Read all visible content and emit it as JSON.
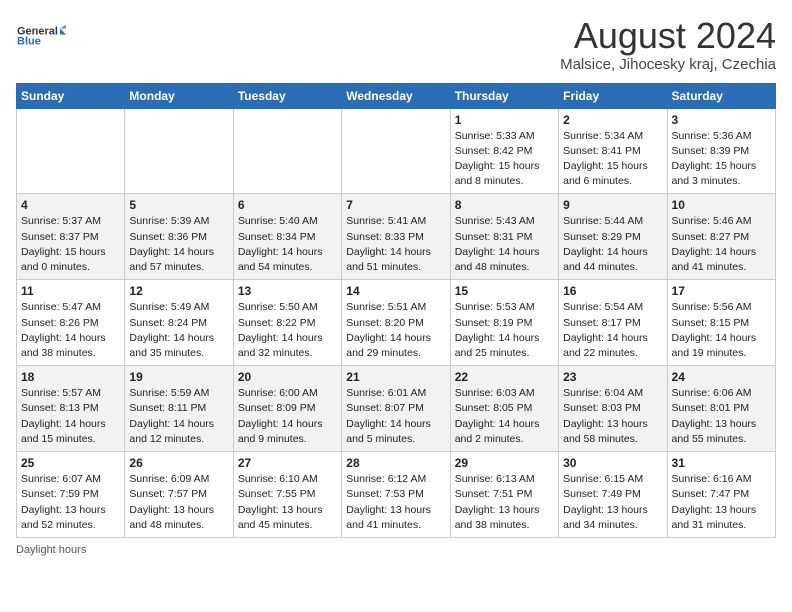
{
  "logo": {
    "line1": "General",
    "line2": "Blue"
  },
  "title": "August 2024",
  "location": "Malsice, Jihocesky kraj, Czechia",
  "days_of_week": [
    "Sunday",
    "Monday",
    "Tuesday",
    "Wednesday",
    "Thursday",
    "Friday",
    "Saturday"
  ],
  "footer_note": "Daylight hours",
  "weeks": [
    [
      {
        "day": "",
        "info": ""
      },
      {
        "day": "",
        "info": ""
      },
      {
        "day": "",
        "info": ""
      },
      {
        "day": "",
        "info": ""
      },
      {
        "day": "1",
        "info": "Sunrise: 5:33 AM\nSunset: 8:42 PM\nDaylight: 15 hours\nand 8 minutes."
      },
      {
        "day": "2",
        "info": "Sunrise: 5:34 AM\nSunset: 8:41 PM\nDaylight: 15 hours\nand 6 minutes."
      },
      {
        "day": "3",
        "info": "Sunrise: 5:36 AM\nSunset: 8:39 PM\nDaylight: 15 hours\nand 3 minutes."
      }
    ],
    [
      {
        "day": "4",
        "info": "Sunrise: 5:37 AM\nSunset: 8:37 PM\nDaylight: 15 hours\nand 0 minutes."
      },
      {
        "day": "5",
        "info": "Sunrise: 5:39 AM\nSunset: 8:36 PM\nDaylight: 14 hours\nand 57 minutes."
      },
      {
        "day": "6",
        "info": "Sunrise: 5:40 AM\nSunset: 8:34 PM\nDaylight: 14 hours\nand 54 minutes."
      },
      {
        "day": "7",
        "info": "Sunrise: 5:41 AM\nSunset: 8:33 PM\nDaylight: 14 hours\nand 51 minutes."
      },
      {
        "day": "8",
        "info": "Sunrise: 5:43 AM\nSunset: 8:31 PM\nDaylight: 14 hours\nand 48 minutes."
      },
      {
        "day": "9",
        "info": "Sunrise: 5:44 AM\nSunset: 8:29 PM\nDaylight: 14 hours\nand 44 minutes."
      },
      {
        "day": "10",
        "info": "Sunrise: 5:46 AM\nSunset: 8:27 PM\nDaylight: 14 hours\nand 41 minutes."
      }
    ],
    [
      {
        "day": "11",
        "info": "Sunrise: 5:47 AM\nSunset: 8:26 PM\nDaylight: 14 hours\nand 38 minutes."
      },
      {
        "day": "12",
        "info": "Sunrise: 5:49 AM\nSunset: 8:24 PM\nDaylight: 14 hours\nand 35 minutes."
      },
      {
        "day": "13",
        "info": "Sunrise: 5:50 AM\nSunset: 8:22 PM\nDaylight: 14 hours\nand 32 minutes."
      },
      {
        "day": "14",
        "info": "Sunrise: 5:51 AM\nSunset: 8:20 PM\nDaylight: 14 hours\nand 29 minutes."
      },
      {
        "day": "15",
        "info": "Sunrise: 5:53 AM\nSunset: 8:19 PM\nDaylight: 14 hours\nand 25 minutes."
      },
      {
        "day": "16",
        "info": "Sunrise: 5:54 AM\nSunset: 8:17 PM\nDaylight: 14 hours\nand 22 minutes."
      },
      {
        "day": "17",
        "info": "Sunrise: 5:56 AM\nSunset: 8:15 PM\nDaylight: 14 hours\nand 19 minutes."
      }
    ],
    [
      {
        "day": "18",
        "info": "Sunrise: 5:57 AM\nSunset: 8:13 PM\nDaylight: 14 hours\nand 15 minutes."
      },
      {
        "day": "19",
        "info": "Sunrise: 5:59 AM\nSunset: 8:11 PM\nDaylight: 14 hours\nand 12 minutes."
      },
      {
        "day": "20",
        "info": "Sunrise: 6:00 AM\nSunset: 8:09 PM\nDaylight: 14 hours\nand 9 minutes."
      },
      {
        "day": "21",
        "info": "Sunrise: 6:01 AM\nSunset: 8:07 PM\nDaylight: 14 hours\nand 5 minutes."
      },
      {
        "day": "22",
        "info": "Sunrise: 6:03 AM\nSunset: 8:05 PM\nDaylight: 14 hours\nand 2 minutes."
      },
      {
        "day": "23",
        "info": "Sunrise: 6:04 AM\nSunset: 8:03 PM\nDaylight: 13 hours\nand 58 minutes."
      },
      {
        "day": "24",
        "info": "Sunrise: 6:06 AM\nSunset: 8:01 PM\nDaylight: 13 hours\nand 55 minutes."
      }
    ],
    [
      {
        "day": "25",
        "info": "Sunrise: 6:07 AM\nSunset: 7:59 PM\nDaylight: 13 hours\nand 52 minutes."
      },
      {
        "day": "26",
        "info": "Sunrise: 6:09 AM\nSunset: 7:57 PM\nDaylight: 13 hours\nand 48 minutes."
      },
      {
        "day": "27",
        "info": "Sunrise: 6:10 AM\nSunset: 7:55 PM\nDaylight: 13 hours\nand 45 minutes."
      },
      {
        "day": "28",
        "info": "Sunrise: 6:12 AM\nSunset: 7:53 PM\nDaylight: 13 hours\nand 41 minutes."
      },
      {
        "day": "29",
        "info": "Sunrise: 6:13 AM\nSunset: 7:51 PM\nDaylight: 13 hours\nand 38 minutes."
      },
      {
        "day": "30",
        "info": "Sunrise: 6:15 AM\nSunset: 7:49 PM\nDaylight: 13 hours\nand 34 minutes."
      },
      {
        "day": "31",
        "info": "Sunrise: 6:16 AM\nSunset: 7:47 PM\nDaylight: 13 hours\nand 31 minutes."
      }
    ]
  ]
}
